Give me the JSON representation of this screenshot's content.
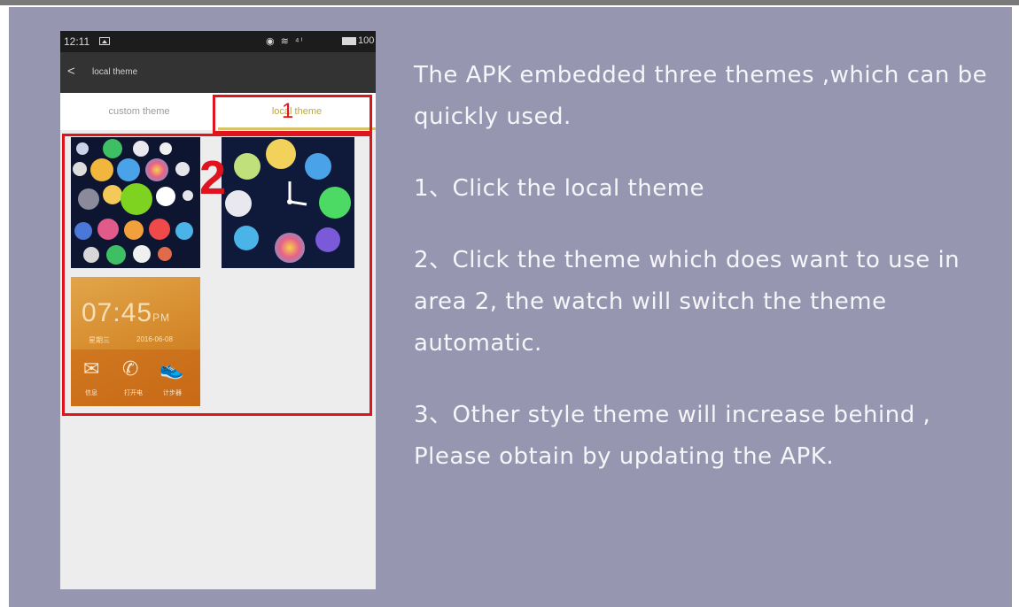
{
  "phone": {
    "status_bar": {
      "time": "12:11",
      "sys_icons": "◉ ≋ ⁴ⁱ",
      "battery_level": "100"
    },
    "app_bar": {
      "back_glyph": "<",
      "title": "local theme"
    },
    "tabs": [
      {
        "label": "custom theme",
        "selected": false
      },
      {
        "label": "local theme",
        "selected": true
      }
    ],
    "themes": [
      {
        "name": "bubble icon theme"
      },
      {
        "name": "clock theme"
      },
      {
        "name": "orange digital theme",
        "time": "07:45",
        "ampm": "PM",
        "date_left": "星期三",
        "date_right": "2016-06-08",
        "icon_labels": [
          "信息",
          "打开电",
          "计步器"
        ]
      }
    ],
    "accent_color": "#d6c46a"
  },
  "callouts": {
    "num_1": "1",
    "num_2": "2",
    "color": "#e0141e"
  },
  "instructions": {
    "intro": "The APK embedded three themes ,which can be quickly used.",
    "step_1": "1、Click the local theme",
    "step_2": "2、Click the theme which does want to use in area 2, the watch will switch the theme automatic.",
    "step_3": "3、Other style theme will increase behind , Please obtain by updating the APK."
  },
  "colors": {
    "panel_background": "#9696b0",
    "instruction_text": "#f5f5fa"
  }
}
